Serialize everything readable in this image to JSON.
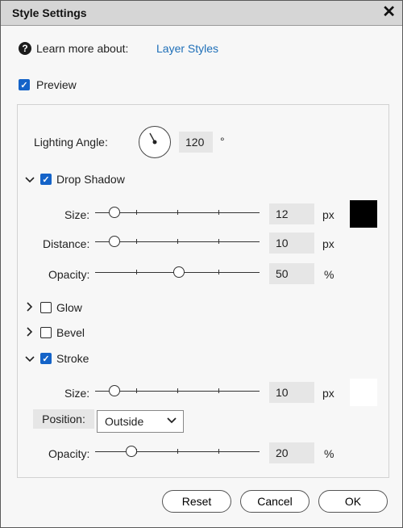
{
  "window": {
    "title": "Style Settings",
    "close_glyph": "✕"
  },
  "help": {
    "text": "Learn more about:",
    "link": "Layer Styles",
    "icon": "question-circle-icon"
  },
  "preview": {
    "label": "Preview",
    "checked": true
  },
  "lighting": {
    "label": "Lighting Angle:",
    "value": "120",
    "unit": "°"
  },
  "drop_shadow": {
    "label": "Drop Shadow",
    "checked": true,
    "expanded": true,
    "size": {
      "label": "Size:",
      "value": "12",
      "unit": "px"
    },
    "distance": {
      "label": "Distance:",
      "value": "10",
      "unit": "px"
    },
    "opacity": {
      "label": "Opacity:",
      "value": "50",
      "unit": "%"
    },
    "color": "#000000"
  },
  "glow": {
    "label": "Glow",
    "checked": false,
    "expanded": false
  },
  "bevel": {
    "label": "Bevel",
    "checked": false,
    "expanded": false
  },
  "stroke": {
    "label": "Stroke",
    "checked": true,
    "expanded": true,
    "size": {
      "label": "Size:",
      "value": "10",
      "unit": "px"
    },
    "position": {
      "label": "Position:",
      "value": "Outside"
    },
    "opacity": {
      "label": "Opacity:",
      "value": "20",
      "unit": "%"
    },
    "color": "#ffffff"
  },
  "buttons": {
    "reset": "Reset",
    "cancel": "Cancel",
    "ok": "OK"
  },
  "colors": {
    "accent": "#1463c8",
    "link": "#1e6fb8",
    "titlebar": "#d6d6d6"
  }
}
